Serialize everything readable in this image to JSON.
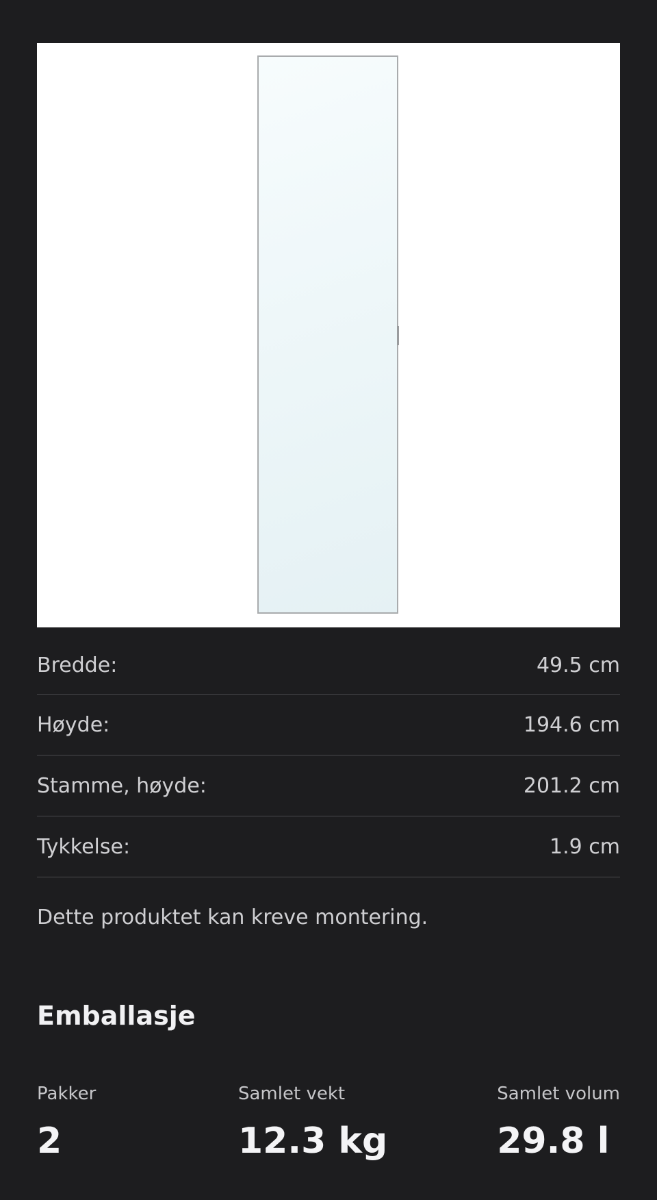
{
  "dimensions": [
    {
      "label": "Bredde:",
      "value": "49.5 cm"
    },
    {
      "label": "Høyde:",
      "value": "194.6 cm"
    },
    {
      "label": "Stamme, høyde:",
      "value": "201.2 cm"
    },
    {
      "label": "Tykkelse:",
      "value": "1.9 cm"
    }
  ],
  "note": "Dette produktet kan kreve montering.",
  "packaging": {
    "title": "Emballasje",
    "items": [
      {
        "label": "Pakker",
        "value": "2"
      },
      {
        "label": "Samlet vekt",
        "value": "12.3 kg"
      },
      {
        "label": "Samlet volum",
        "value": "29.8 l"
      }
    ]
  },
  "colors": {
    "background": "#1d1d1f",
    "text": "#cfcfd2",
    "divider": "#4a4a4e"
  }
}
